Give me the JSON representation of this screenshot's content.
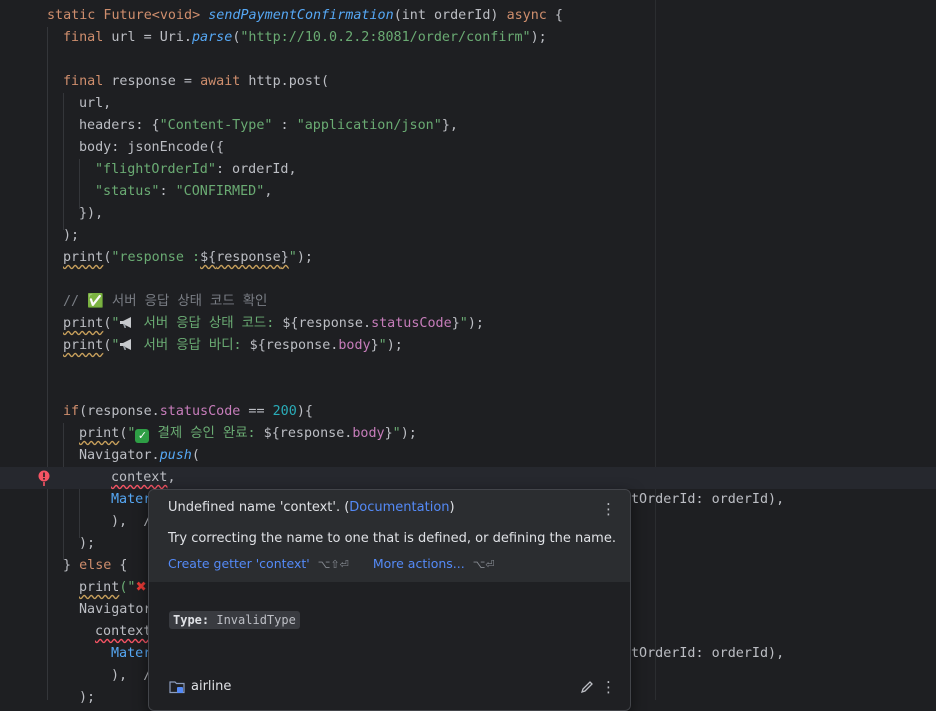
{
  "editor": {
    "lines": {
      "l1": {
        "a": "static Future<void> ",
        "b": "sendPaymentConfirmation",
        "c": "(int orderId) ",
        "d": "async",
        "e": " {"
      },
      "l2": {
        "a": "final",
        "b": " url = Uri.",
        "c": "parse",
        "d": "(",
        "e": "\"http://10.0.2.2:8081/order/confirm\"",
        "f": ");"
      },
      "l4": {
        "a": "final",
        "b": " response = ",
        "c": "await",
        "d": " http.post("
      },
      "l5": "url,",
      "l6": {
        "a": "headers: {",
        "b": "\"Content-Type\"",
        "c": " : ",
        "d": "\"application/json\"",
        "e": "},"
      },
      "l7": "body: jsonEncode({",
      "l8": {
        "a": "\"flightOrderId\"",
        "b": ": orderId,"
      },
      "l9": {
        "a": "\"status\"",
        "b": ": ",
        "c": "\"CONFIRMED\"",
        "d": ","
      },
      "l10": "}),",
      "l11": ");",
      "l12": {
        "a": "print",
        "b": "(",
        "c": "\"response :",
        "d": "${",
        "e": "response",
        "f": "}",
        "g": "\"",
        "h": ");"
      },
      "l14": "// ✅ 서버 응답 상태 코드 확인",
      "l15": {
        "a": "print",
        "b": "(",
        "c": "\"",
        "d": " 서버 응답 상태 코드: ",
        "e": "${",
        "f": "response.",
        "g": "statusCode",
        "h": "}",
        "i": "\"",
        "j": ");"
      },
      "l16": {
        "a": "print",
        "b": "(",
        "c": "\"",
        "d": " 서버 응답 바디: ",
        "e": "${",
        "f": "response.",
        "g": "body",
        "h": "}",
        "i": "\"",
        "j": ");"
      },
      "l19": {
        "a": "if",
        "b": "(response.",
        "c": "statusCode",
        "d": " == ",
        "e": "200",
        "f": "){"
      },
      "l20": {
        "a": "print",
        "b": "(",
        "c": "\"",
        "d": " 결제 승인 완료: ",
        "e": "${",
        "f": "response.",
        "g": "body",
        "h": "}",
        "i": "\"",
        "j": ");"
      },
      "l21": {
        "a": "Navigator.",
        "b": "push",
        "c": "("
      },
      "l22": {
        "a": "context",
        "b": ","
      },
      "l23": {
        "a": "Mater",
        "b": "tOrderId: orderId),"
      },
      "l24": "),  /",
      "l25": ");",
      "l26": {
        "a": "} ",
        "b": "else",
        "c": " {"
      },
      "l27": {
        "a": "print",
        "b": "(\""
      },
      "l28": "Navigator",
      "l29": "context",
      "l30": {
        "a": "Mater",
        "b": "tOrderId: orderId),"
      },
      "l31": "),  /",
      "l32": ");"
    }
  },
  "popup": {
    "title_prefix": "Undefined name 'context'. (",
    "title_link": "Documentation",
    "title_suffix": ")",
    "description": "Try correcting the name to one that is defined, or defining the name.",
    "action1": "Create getter 'context'",
    "action1_shortcut": "⌥⇧⏎",
    "action2": "More actions...",
    "action2_shortcut": "⌥⏎",
    "type_label": "Type:",
    "type_value": "InvalidType",
    "footer_module": "airline"
  },
  "colors": {
    "background": "#1e1f22",
    "keyword": "#cf8e6d",
    "string": "#6aab73",
    "function": "#56a8f5",
    "field": "#c77dbb",
    "number": "#2aacb8",
    "link": "#548af7",
    "error": "#f75464"
  }
}
